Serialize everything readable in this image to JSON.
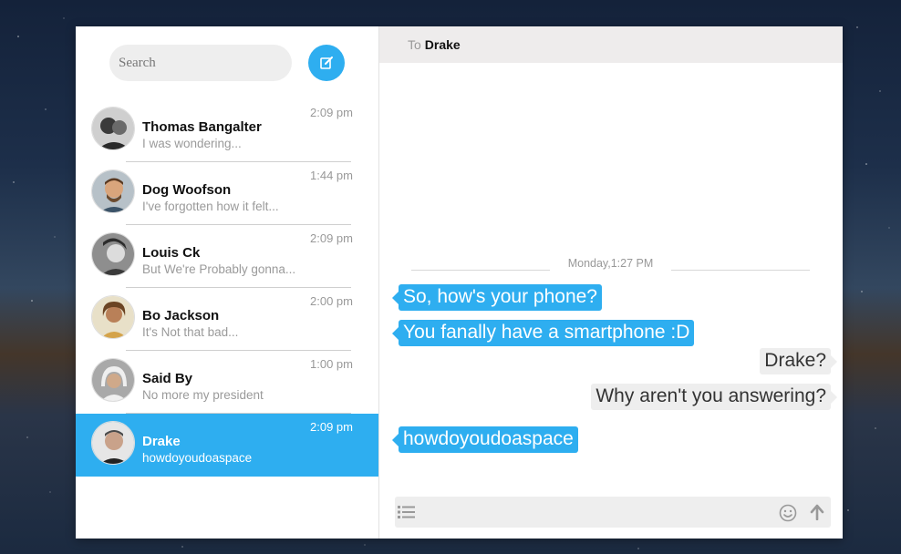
{
  "search": {
    "placeholder": "Search"
  },
  "compose": {
    "icon": "compose-icon"
  },
  "colors": {
    "accent": "#2eaef0",
    "bubble_me": "#eeeeee",
    "header_bg": "#eeecec"
  },
  "contacts": [
    {
      "name": "Thomas Bangalter",
      "preview": "I was wondering...",
      "time": "2:09 pm",
      "active": false
    },
    {
      "name": "Dog Woofson",
      "preview": "I've forgotten how it felt...",
      "time": "1:44 pm",
      "active": false
    },
    {
      "name": "Louis Ck",
      "preview": "But We're Probably gonna...",
      "time": "2:09 pm",
      "active": false
    },
    {
      "name": "Bo Jackson",
      "preview": "It's Not that bad...",
      "time": "2:00 pm",
      "active": false
    },
    {
      "name": "Said By",
      "preview": "No more my president",
      "time": "1:00 pm",
      "active": false
    },
    {
      "name": "Drake",
      "preview": "howdoyoudoaspace",
      "time": "2:09 pm",
      "active": true
    }
  ],
  "chat": {
    "to_label": "To",
    "to_name": "Drake",
    "day_separator": "Monday,1:27 PM",
    "messages": [
      {
        "from": "you",
        "text": "So, how's your phone?"
      },
      {
        "from": "you",
        "text": "You fanally have a smartphone :D"
      },
      {
        "from": "me",
        "text": "Drake?"
      },
      {
        "from": "me",
        "text": "Why aren't you answering?"
      },
      {
        "from": "you",
        "text": "howdoyoudoaspace"
      }
    ]
  },
  "composer": {
    "input_value": "",
    "icons": [
      "list-icon",
      "smiley-icon",
      "send-arrow-icon"
    ]
  }
}
